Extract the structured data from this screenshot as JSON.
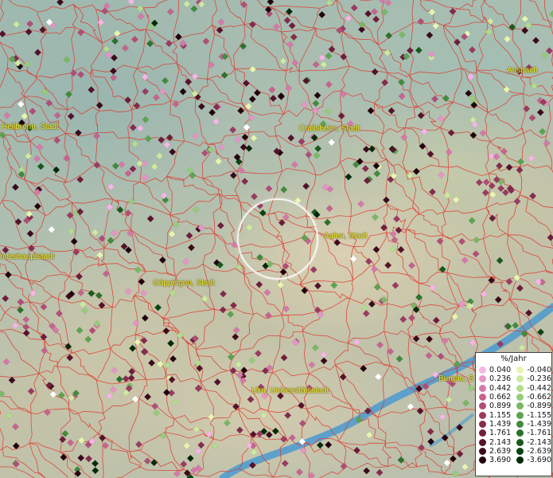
{
  "map": {
    "cities": [
      {
        "id": "heilbronn",
        "label": "Heilbronn, Stadt"
      },
      {
        "id": "crailsheim",
        "label": "Crailsheim, Stadt"
      },
      {
        "id": "ansbach",
        "label": "Ansbach"
      },
      {
        "id": "aalen",
        "label": "Aalen, Stadt"
      },
      {
        "id": "landeshauptstadt",
        "label": "ndeshauptstadt"
      },
      {
        "id": "goeppingen",
        "label": "Göppingen, Stadt"
      },
      {
        "id": "ulm",
        "label": "Ulm, Universitätsstadt"
      },
      {
        "id": "burgau",
        "label": "Burgau, S"
      }
    ],
    "colors": {
      "border_lines": "#e0342a",
      "river": "#4a9ad0",
      "city_label": "#f2ee32",
      "neutral_point": "#ffffff"
    }
  },
  "legend": {
    "title": "%/Jahr",
    "positive": [
      {
        "label": "0.040",
        "color": "#f5b6e6"
      },
      {
        "label": "0.236",
        "color": "#e595c7"
      },
      {
        "label": "0.442",
        "color": "#d57aa8"
      },
      {
        "label": "0.662",
        "color": "#c5648f"
      },
      {
        "label": "0.899",
        "color": "#b04e78"
      },
      {
        "label": "1.155",
        "color": "#9a3c62"
      },
      {
        "label": "1.439",
        "color": "#842c4e"
      },
      {
        "label": "1.761",
        "color": "#6e1e3c"
      },
      {
        "label": "2.143",
        "color": "#56122b"
      },
      {
        "label": "2.639",
        "color": "#3c0a1c"
      },
      {
        "label": "3.690",
        "color": "#22030d"
      }
    ],
    "negative": [
      {
        "label": "-0.040",
        "color": "#e8f5b0"
      },
      {
        "label": "-0.236",
        "color": "#cdeaa0"
      },
      {
        "label": "-0.442",
        "color": "#b3dc8e"
      },
      {
        "label": "-0.662",
        "color": "#96cc7a"
      },
      {
        "label": "-0.899",
        "color": "#79b865"
      },
      {
        "label": "-1.155",
        "color": "#5ca350"
      },
      {
        "label": "-1.439",
        "color": "#428b3e"
      },
      {
        "label": "-1.761",
        "color": "#2b722d"
      },
      {
        "label": "-2.143",
        "color": "#185a1e"
      },
      {
        "label": "-2.639",
        "color": "#0b4313"
      },
      {
        "label": "-3.690",
        "color": "#032b09"
      }
    ]
  }
}
